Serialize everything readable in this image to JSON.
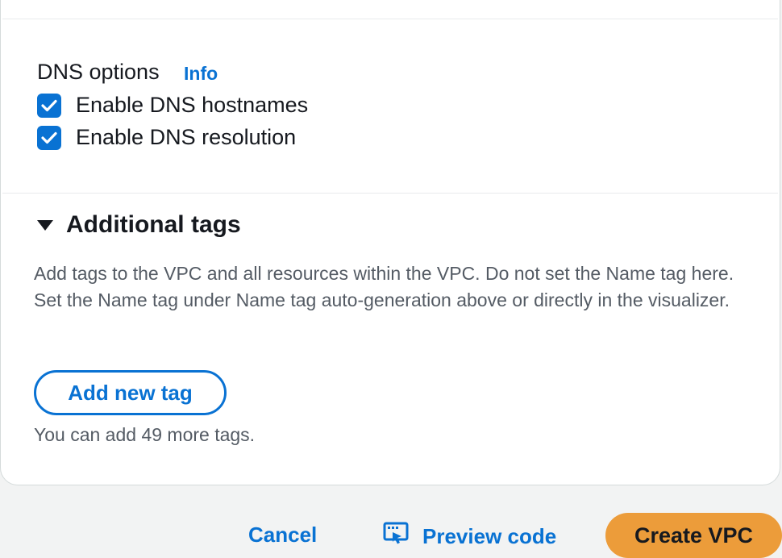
{
  "dns_options": {
    "title": "DNS options",
    "info_link": "Info",
    "checkboxes": [
      {
        "label": "Enable DNS hostnames",
        "checked": true
      },
      {
        "label": "Enable DNS resolution",
        "checked": true
      }
    ]
  },
  "additional_tags": {
    "title": "Additional tags",
    "expanded": true,
    "description": "Add tags to the VPC and all resources within the VPC. Do not set the Name tag here. Set the Name tag under Name tag auto-generation above or directly in the visualizer.",
    "add_button_label": "Add new tag",
    "remaining_text": "You can add 49 more tags."
  },
  "footer": {
    "cancel_label": "Cancel",
    "preview_label": "Preview code",
    "create_label": "Create VPC"
  },
  "colors": {
    "accent": "#0972d3",
    "primary_button": "#ec9c3a"
  }
}
